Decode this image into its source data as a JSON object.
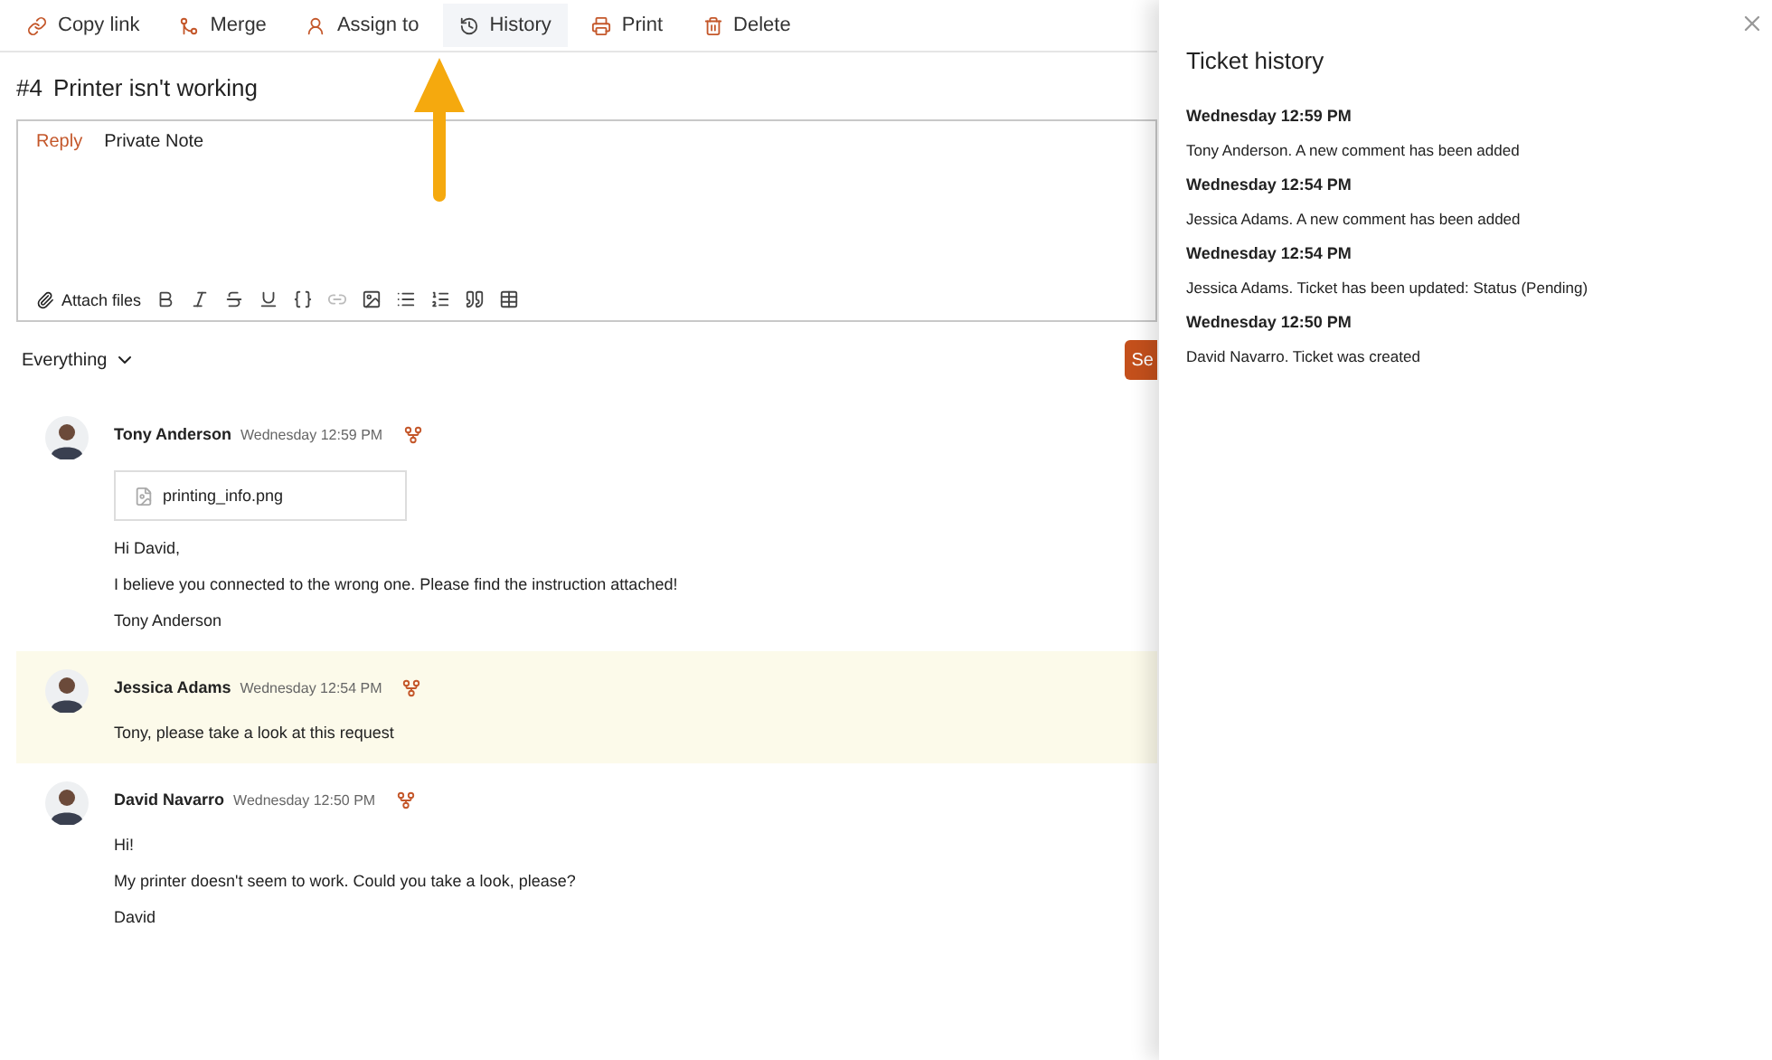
{
  "toolbar": [
    {
      "label": "Copy link",
      "selected": false
    },
    {
      "label": "Merge",
      "selected": false
    },
    {
      "label": "Assign to",
      "selected": false
    },
    {
      "label": "History",
      "selected": true
    },
    {
      "label": "Print",
      "selected": false
    },
    {
      "label": "Delete",
      "selected": false
    }
  ],
  "ticket": {
    "number": "#4",
    "title": "Printer isn't working"
  },
  "editor": {
    "tabs": [
      {
        "label": "Reply",
        "selected": true
      },
      {
        "label": "Private Note",
        "selected": false
      }
    ],
    "attach": "Attach files",
    "tools": [
      {
        "disabled": false
      },
      {
        "disabled": false
      },
      {
        "disabled": false
      },
      {
        "disabled": false
      },
      {
        "disabled": false
      },
      {
        "disabled": true
      },
      {
        "disabled": false
      },
      {
        "disabled": false
      },
      {
        "disabled": false
      },
      {
        "disabled": false
      },
      {
        "disabled": false
      }
    ]
  },
  "filter": "Everything",
  "send_button": "Se",
  "messages": [
    {
      "author": "Tony Anderson",
      "time": "Wednesday 12:59 PM",
      "private": false,
      "attachment": "printing_info.png",
      "paragraphs": [
        "Hi David,",
        "I believe you connected to the wrong one. Please find the instruction attached!",
        "Tony Anderson"
      ]
    },
    {
      "author": "Jessica Adams",
      "time": "Wednesday 12:54 PM",
      "private": true,
      "paragraphs": [
        "Tony, please take a look at this request"
      ]
    },
    {
      "author": "David Navarro",
      "time": "Wednesday 12:50 PM",
      "private": false,
      "paragraphs": [
        "Hi!",
        "My printer doesn't seem to work. Could you take a look, please?",
        "David"
      ]
    }
  ],
  "history_panel": {
    "title": "Ticket history",
    "entries": [
      {
        "time": "Wednesday 12:59 PM",
        "text": "Tony Anderson. A new comment has been added"
      },
      {
        "time": "Wednesday 12:54 PM",
        "text": "Jessica Adams. A new comment has been added"
      },
      {
        "time": "Wednesday 12:54 PM",
        "text": "Jessica Adams. Ticket has been updated: Status (Pending)"
      },
      {
        "time": "Wednesday 12:50 PM",
        "text": "David Navarro. Ticket was created"
      }
    ]
  }
}
